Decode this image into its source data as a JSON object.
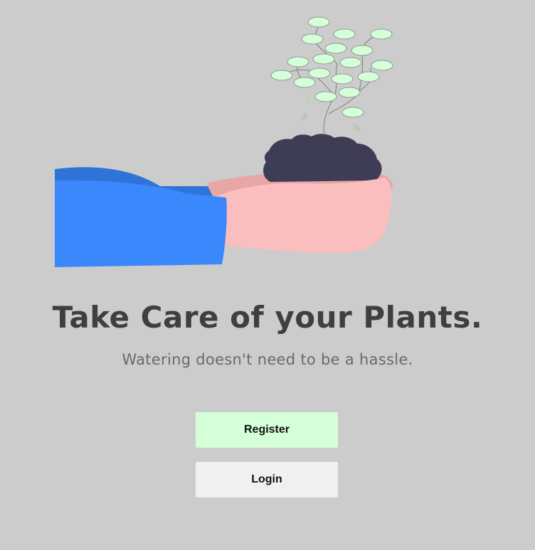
{
  "hero": {
    "title": "Take Care of your Plants.",
    "subtitle": "Watering doesn't need to be a hassle.",
    "illustration": "hands-holding-plant-illustration"
  },
  "actions": {
    "register_label": "Register",
    "login_label": "Login"
  },
  "colors": {
    "background": "#cccccc",
    "title": "#3f3f3f",
    "subtitle": "#6a6a6a",
    "register_button": "#d4ffd9",
    "login_button": "#f0f0f0",
    "leaf": "#d4ffd9",
    "sleeve": "#3b88fc",
    "sleeve_shadow": "#2e74d8",
    "skin": "#fbbebe",
    "skin_shadow": "#e8a6a6",
    "soil": "#3f3d56"
  }
}
